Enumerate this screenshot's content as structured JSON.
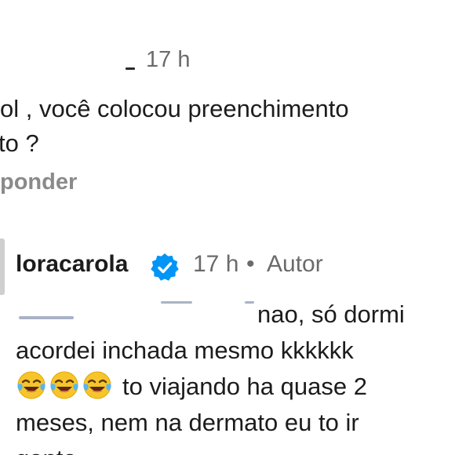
{
  "comment_top": {
    "time": "17 h",
    "text_line1": "ol , você colocou preenchimento",
    "text_line2": "to ?",
    "reply_label": "ponder"
  },
  "author_reply": {
    "username": "loracarola",
    "verified": true,
    "time": "17 h",
    "separator": "•",
    "author_badge": "Autor",
    "line1": "nao, só dormi",
    "line2": "acordei inchada mesmo kkkkkk",
    "emoji": [
      "face-with-tears-of-joy-icon",
      "face-with-tears-of-joy-icon",
      "face-with-tears-of-joy-icon"
    ],
    "line3_text": "to viajando ha quase 2",
    "line4": "meses, nem na dermato eu to ir",
    "line5": "gente"
  },
  "colors": {
    "text": "#1c1c1c",
    "muted": "#6b6b6b",
    "reply": "#8a8a8a",
    "verified": "#0095f6"
  }
}
